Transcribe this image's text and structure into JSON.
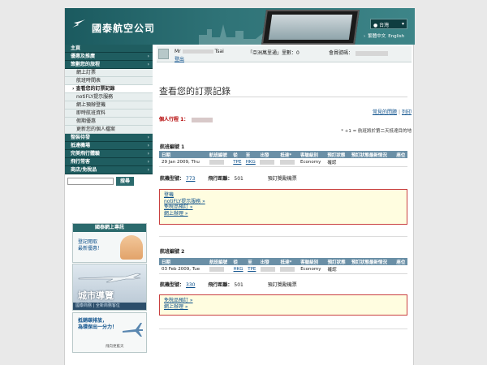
{
  "header": {
    "brand_name": "國泰航空公司",
    "region": "台灣",
    "lang_tc": "繁體中文",
    "lang_en": "English",
    "lang_prefix": "›"
  },
  "sidebar": {
    "nav_top": [
      {
        "label": "主頁",
        "arrow": ""
      },
      {
        "label": "優惠及推廣",
        "arrow": "›"
      },
      {
        "label": "策劃您的旅程",
        "arrow": "›"
      }
    ],
    "sub_items": [
      {
        "label": "網上訂票",
        "active": false
      },
      {
        "label": "航班時間表",
        "active": false
      },
      {
        "label": "› 查看您的訂票記錄",
        "active": true
      },
      {
        "label": "notiFLY提示服務",
        "active": false
      },
      {
        "label": "網上預辦登機",
        "active": false
      },
      {
        "label": "即時航班資料",
        "active": false
      },
      {
        "label": "假期優惠",
        "active": false
      },
      {
        "label": "更新您的個人檔案",
        "active": false
      }
    ],
    "nav_bottom": [
      {
        "label": "整裝待發",
        "arrow": "›"
      },
      {
        "label": "抵達機場",
        "arrow": "›"
      },
      {
        "label": "完美飛行體驗",
        "arrow": "›"
      },
      {
        "label": "飛行常客",
        "arrow": "›"
      },
      {
        "label": "商店/免稅品",
        "arrow": "›"
      }
    ],
    "search_button": "搜尋",
    "promo1": {
      "header": "國泰網上專訊",
      "line1": "登記閱取",
      "line2": "最新優惠！"
    },
    "promo2": {
      "title": "城市導覽",
      "strip": "國泰商務 | 全新商務客位"
    },
    "promo3": {
      "line1": "抵銷碳排放，",
      "line2": "為環保出一分力！",
      "small": "飛向更藍天"
    }
  },
  "user": {
    "title": "Mr",
    "surname": "Tsai",
    "logout": "登出",
    "miles_label": "「亞洲萬里通」里數：",
    "miles_value": "0",
    "member_label": "會員號碼："
  },
  "main": {
    "page_title": "查看您的訂票記錄",
    "link_common": "常見的問題",
    "link_print": "列印",
    "group_label": "個人行程 1：",
    "legend": "* +1 = 航班將於第二天抵達目的地",
    "table_headers": [
      "日期",
      "航班編號",
      "從",
      "至",
      "出發",
      "抵達*",
      "客艙級別",
      "預訂狀態",
      "預訂狀態最新情況",
      "座位"
    ],
    "trips": [
      {
        "title": "航班編號 1",
        "date": "29 Jan 2009, Thu",
        "from": "TPE",
        "to": "HKG",
        "cabin": "Economy",
        "status": "確認",
        "aircraft_label": "航機型號：",
        "aircraft": "773",
        "distance_label": "飛行距離：",
        "distance": "501",
        "extra": "預訂獎勵機票",
        "services": [
          "登機",
          "notiFLY提示服務 »",
          "免稅品預訂 »",
          "網上辦理 »"
        ]
      },
      {
        "title": "航班編號 2",
        "date": "03 Feb 2009, Tue",
        "from": "HKG",
        "to": "TPE",
        "cabin": "Economy",
        "status": "確認",
        "aircraft_label": "航機型號：",
        "aircraft": "330",
        "distance_label": "飛行距離：",
        "distance": "501",
        "extra": "預訂獎勵機票",
        "services": [
          "免稅品預訂 »",
          "網上辦理 »"
        ]
      }
    ]
  },
  "colors": {
    "header_teal": "#1b5a5f",
    "nav_teal": "#1f5d60",
    "table_header": "#6a8fa6",
    "link_blue": "#0b4f8a",
    "alert_red": "#b30000"
  }
}
